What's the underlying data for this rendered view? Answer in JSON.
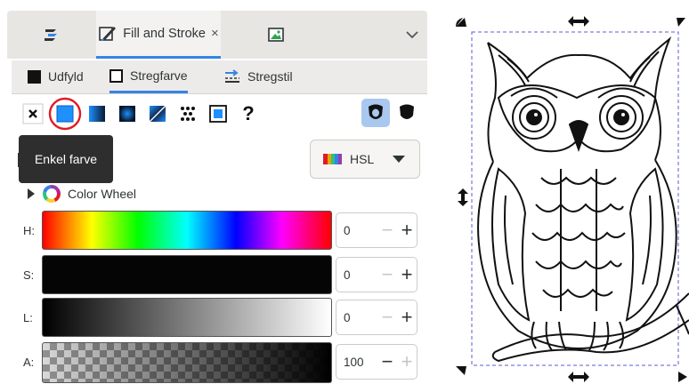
{
  "tabs": {
    "fill_stroke_title": "Fill and Stroke",
    "close_glyph": "×"
  },
  "subtabs": {
    "fill": "Udfyld",
    "stroke_paint": "Stregfarve",
    "stroke_style": "Stregstil"
  },
  "paint_modes": {
    "unset_glyph": "?"
  },
  "tooltip": {
    "text": "Enkel farve"
  },
  "color_mode": {
    "selected": "HSL"
  },
  "color_wheel": {
    "label": "Color Wheel"
  },
  "sliders": [
    {
      "label": "H:",
      "value": "0",
      "minus_enabled": false,
      "plus_enabled": true
    },
    {
      "label": "S:",
      "value": "0",
      "minus_enabled": false,
      "plus_enabled": true
    },
    {
      "label": "L:",
      "value": "0",
      "minus_enabled": false,
      "plus_enabled": true
    },
    {
      "label": "A:",
      "value": "100",
      "minus_enabled": true,
      "plus_enabled": false
    }
  ],
  "colors": {
    "accent": "#3584e4",
    "flat_color_button": "#1e90ff",
    "highlight_ring": "#e01b24",
    "selection_dash": "#5b5bd6"
  }
}
